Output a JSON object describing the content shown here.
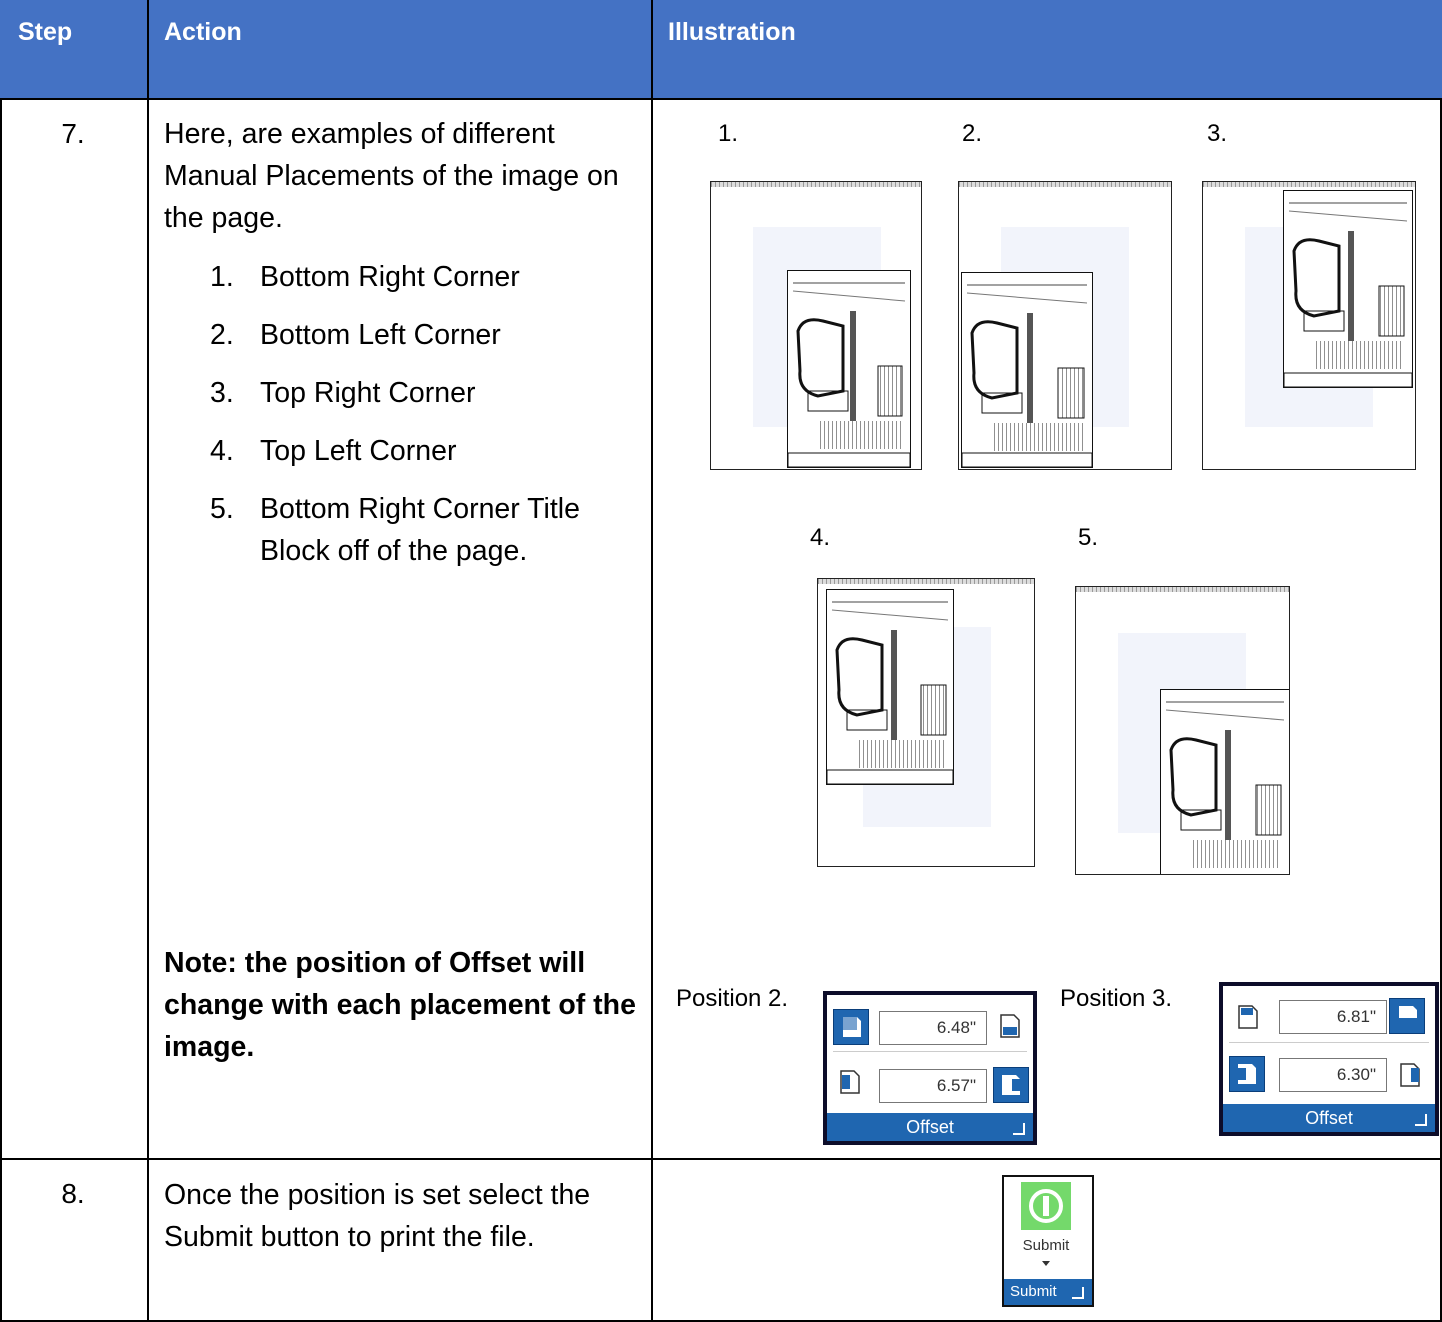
{
  "header": {
    "step": "Step",
    "action": "Action",
    "illustration": "Illustration"
  },
  "row7": {
    "step": "7.",
    "intro": "Here, are examples of different Manual Placements of the image on the page.",
    "placements": [
      {
        "num": "1.",
        "text": "Bottom Right Corner"
      },
      {
        "num": "2.",
        "text": "Bottom Left Corner"
      },
      {
        "num": "3.",
        "text": "Top Right Corner"
      },
      {
        "num": "4.",
        "text": "Top Left Corner"
      },
      {
        "num": "5.",
        "text": "Bottom Right Corner Title Block off of the page."
      }
    ],
    "note": "Note: the position of Offset will change with each placement of the image.",
    "illustration_labels": [
      "1.",
      "2.",
      "3.",
      "4.",
      "5."
    ],
    "offset_panels": [
      {
        "label": "Position 2.",
        "top_value": "6.48\"",
        "bottom_value": "6.57\"",
        "title": "Offset"
      },
      {
        "label": "Position 3.",
        "top_value": "6.81\"",
        "bottom_value": "6.30\"",
        "title": "Offset"
      }
    ]
  },
  "row8": {
    "step": "8.",
    "text": "Once the position is set select the Submit button to print the file.",
    "submit_icon": "power-icon",
    "submit_label": "Submit",
    "submit_group": "Submit"
  }
}
